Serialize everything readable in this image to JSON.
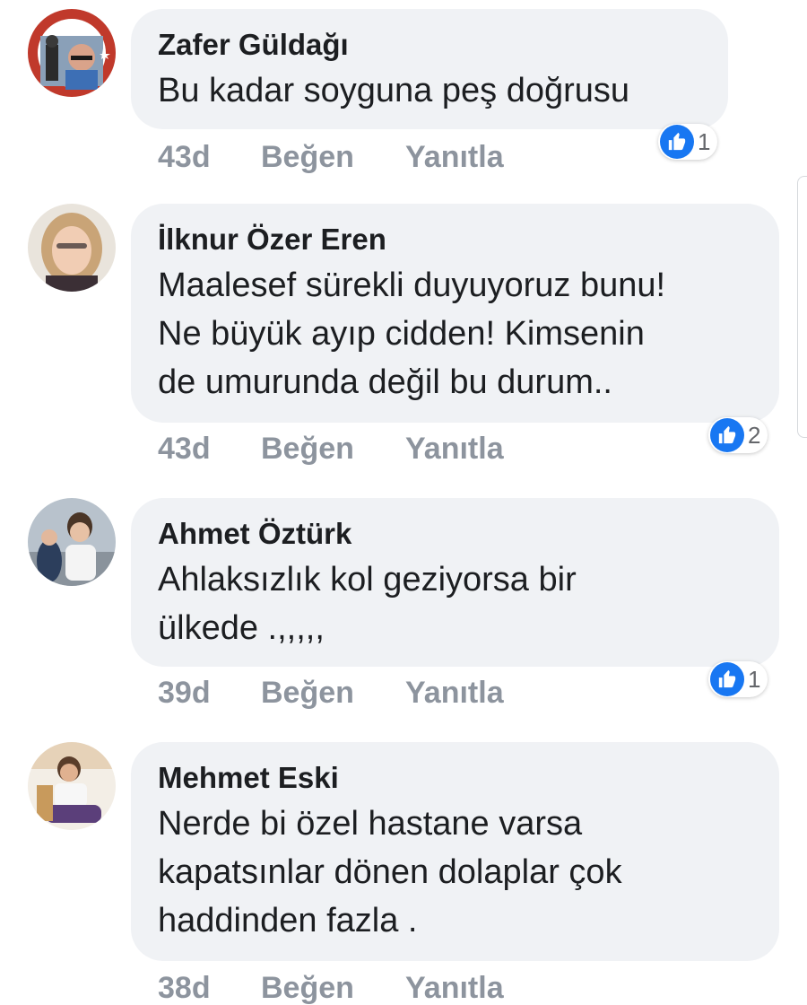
{
  "icons": {
    "like": "thumbs-up-icon"
  },
  "colors": {
    "bubble": "#f0f2f5",
    "like_blue": "#1877f2",
    "meta_gray": "#8d949e"
  },
  "comments": [
    {
      "author": "Zafer Güldağı",
      "lines": [
        "Bu kadar soyguna peş doğrusu"
      ],
      "time": "43d",
      "like_label": "Beğen",
      "reply_label": "Yanıtla",
      "reactions": "1"
    },
    {
      "author": "İlknur Özer Eren",
      "lines": [
        "Maalesef sürekli duyuyoruz bunu!",
        "Ne büyük ayıp cidden! Kimsenin",
        "de umurunda değil bu durum.."
      ],
      "time": "43d",
      "like_label": "Beğen",
      "reply_label": "Yanıtla",
      "reactions": "2"
    },
    {
      "author": "Ahmet Öztürk",
      "lines": [
        "Ahlaksızlık kol geziyorsa bir",
        "ülkede .,,,,,"
      ],
      "time": "39d",
      "like_label": "Beğen",
      "reply_label": "Yanıtla",
      "reactions": "1"
    },
    {
      "author": "Mehmet Eski",
      "lines": [
        "Nerde bi özel hastane varsa",
        "kapatsınlar dönen dolaplar çok",
        "haddinden fazla ."
      ],
      "time": "38d",
      "like_label": "Beğen",
      "reply_label": "Yanıtla",
      "reactions": ""
    }
  ]
}
